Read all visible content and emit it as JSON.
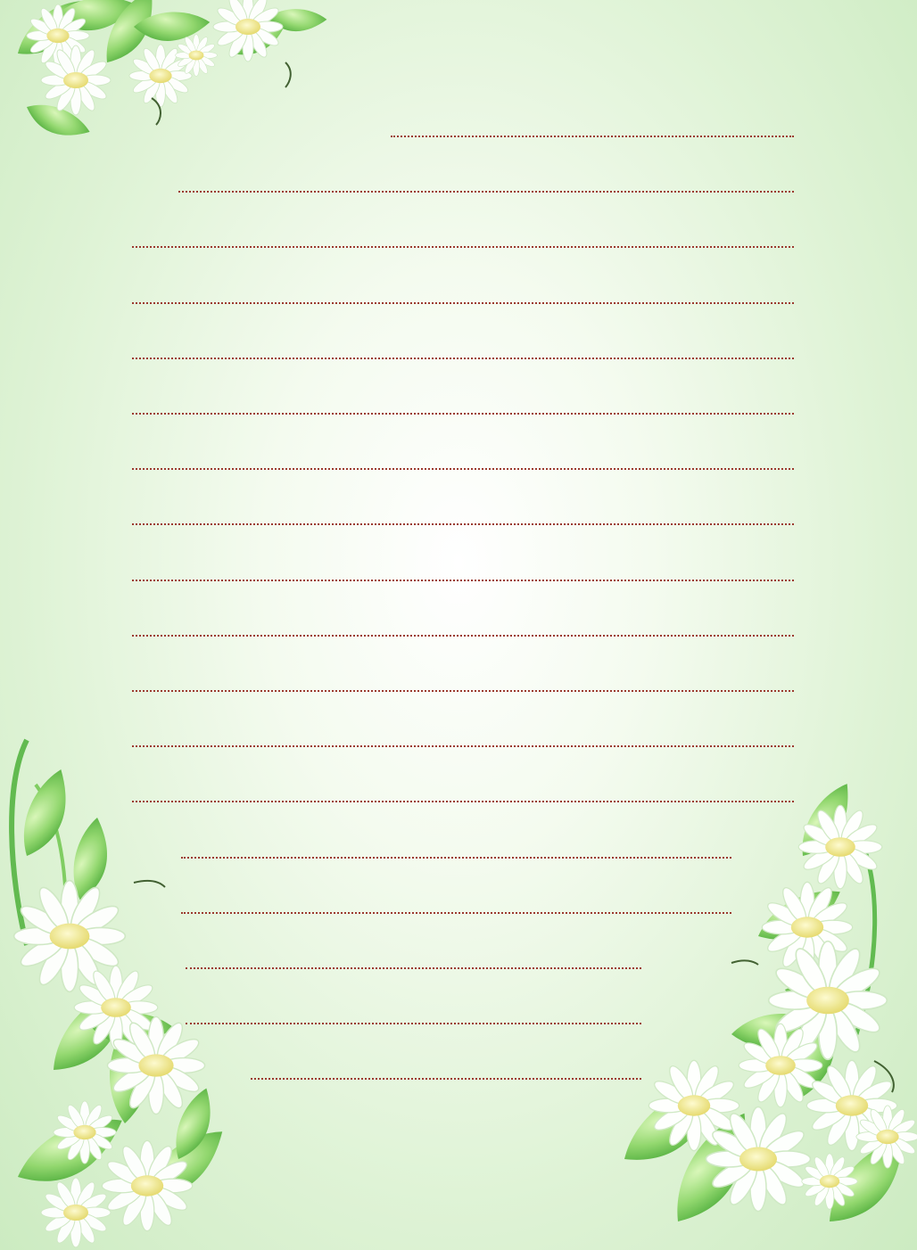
{
  "page": {
    "background_color": "#e3f5db",
    "line_color": "#9b3a2e",
    "decorations": [
      "daisy-flowers-top-left",
      "daisy-flowers-bottom-left",
      "daisy-flowers-bottom-right"
    ]
  },
  "writing_lines": {
    "count": 18,
    "style": "dotted"
  }
}
